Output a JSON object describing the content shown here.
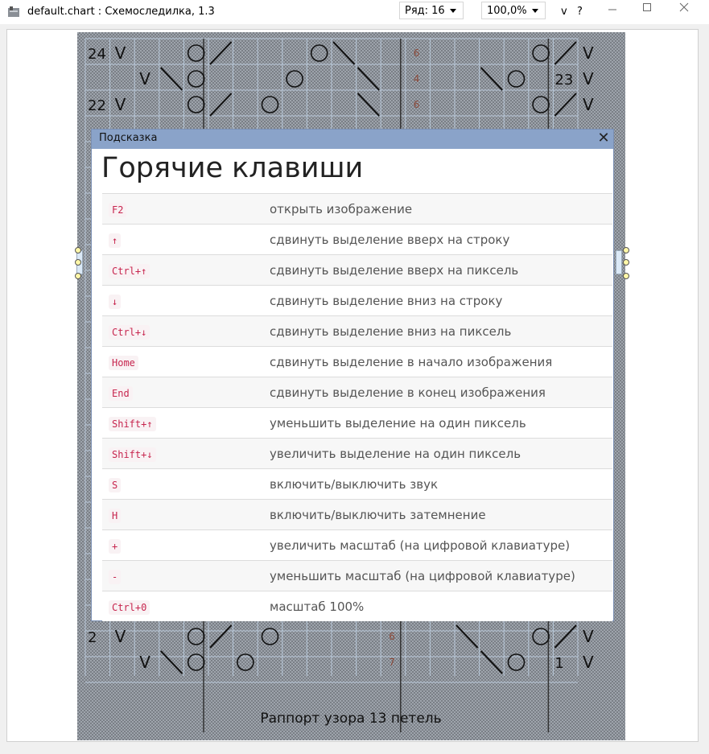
{
  "window": {
    "title": "default.chart : Схемоследилка, 1.3",
    "row_selector": "Ряд: 16",
    "zoom_selector": "100,0%",
    "menu_v": "v",
    "help": "?"
  },
  "chart": {
    "caption": "Раппорт узора 13 петель",
    "top_rows": [
      {
        "left_num": "24",
        "right_num": "",
        "cells": [
          "V",
          "",
          "",
          "O",
          "/",
          "",
          "",
          "",
          "O",
          "\\",
          "",
          "",
          "6",
          "",
          "",
          "",
          "",
          "O",
          "/",
          "V"
        ]
      },
      {
        "left_num": "",
        "right_num": "23",
        "cells": [
          "",
          "V",
          "\\",
          "O",
          "",
          "",
          "",
          "O",
          "",
          "",
          "\\",
          "",
          "4",
          "",
          "",
          "\\",
          "O",
          "",
          "",
          "V"
        ]
      },
      {
        "left_num": "22",
        "right_num": "",
        "cells": [
          "V",
          "",
          "",
          "O",
          "/",
          "",
          "O",
          "",
          "",
          "",
          "\\",
          "",
          "6",
          "",
          "",
          "",
          "",
          "O",
          "/",
          "V"
        ]
      }
    ],
    "bottom_rows": [
      {
        "left_num": "2",
        "right_num": "",
        "cells": [
          "V",
          "",
          "",
          "O",
          "/",
          "",
          "O",
          "",
          "",
          "",
          "",
          "6",
          "",
          "",
          "\\",
          "",
          "",
          "O",
          "/",
          "V"
        ]
      },
      {
        "left_num": "",
        "right_num": "1",
        "cells": [
          "",
          "V",
          "\\",
          "O",
          "",
          "O",
          "",
          "",
          "",
          "",
          "",
          "7",
          "",
          "",
          "",
          "\\",
          "O",
          "",
          "",
          "V"
        ]
      }
    ]
  },
  "dialog": {
    "caption": "Подсказка",
    "close_glyph": "✕",
    "title": "Горячие клавиши",
    "hotkeys": [
      {
        "key": "F2",
        "desc": "открыть изображение"
      },
      {
        "key": "↑",
        "desc": "сдвинуть выделение вверх на строку"
      },
      {
        "key": "Ctrl+↑",
        "desc": "сдвинуть выделение вверх на пиксель"
      },
      {
        "key": "↓",
        "desc": "сдвинуть выделение вниз на строку"
      },
      {
        "key": "Ctrl+↓",
        "desc": "сдвинуть выделение вниз на пиксель"
      },
      {
        "key": "Home",
        "desc": "сдвинуть выделение в начало изображения"
      },
      {
        "key": "End",
        "desc": "сдвинуть выделение в конец изображения"
      },
      {
        "key": "Shift+↑",
        "desc": "уменьшить выделение на один пиксель"
      },
      {
        "key": "Shift+↓",
        "desc": "увеличить выделение на один пиксель"
      },
      {
        "key": "S",
        "desc": "включить/выключить звук"
      },
      {
        "key": "H",
        "desc": "включить/выключить затемнение"
      },
      {
        "key": "+",
        "desc": "увеличить масштаб (на цифровой клавиатуре)"
      },
      {
        "key": "-",
        "desc": "уменьшить масштаб (на цифровой клавиатуре)"
      },
      {
        "key": "Ctrl+0",
        "desc": "масштаб 100%"
      }
    ]
  }
}
